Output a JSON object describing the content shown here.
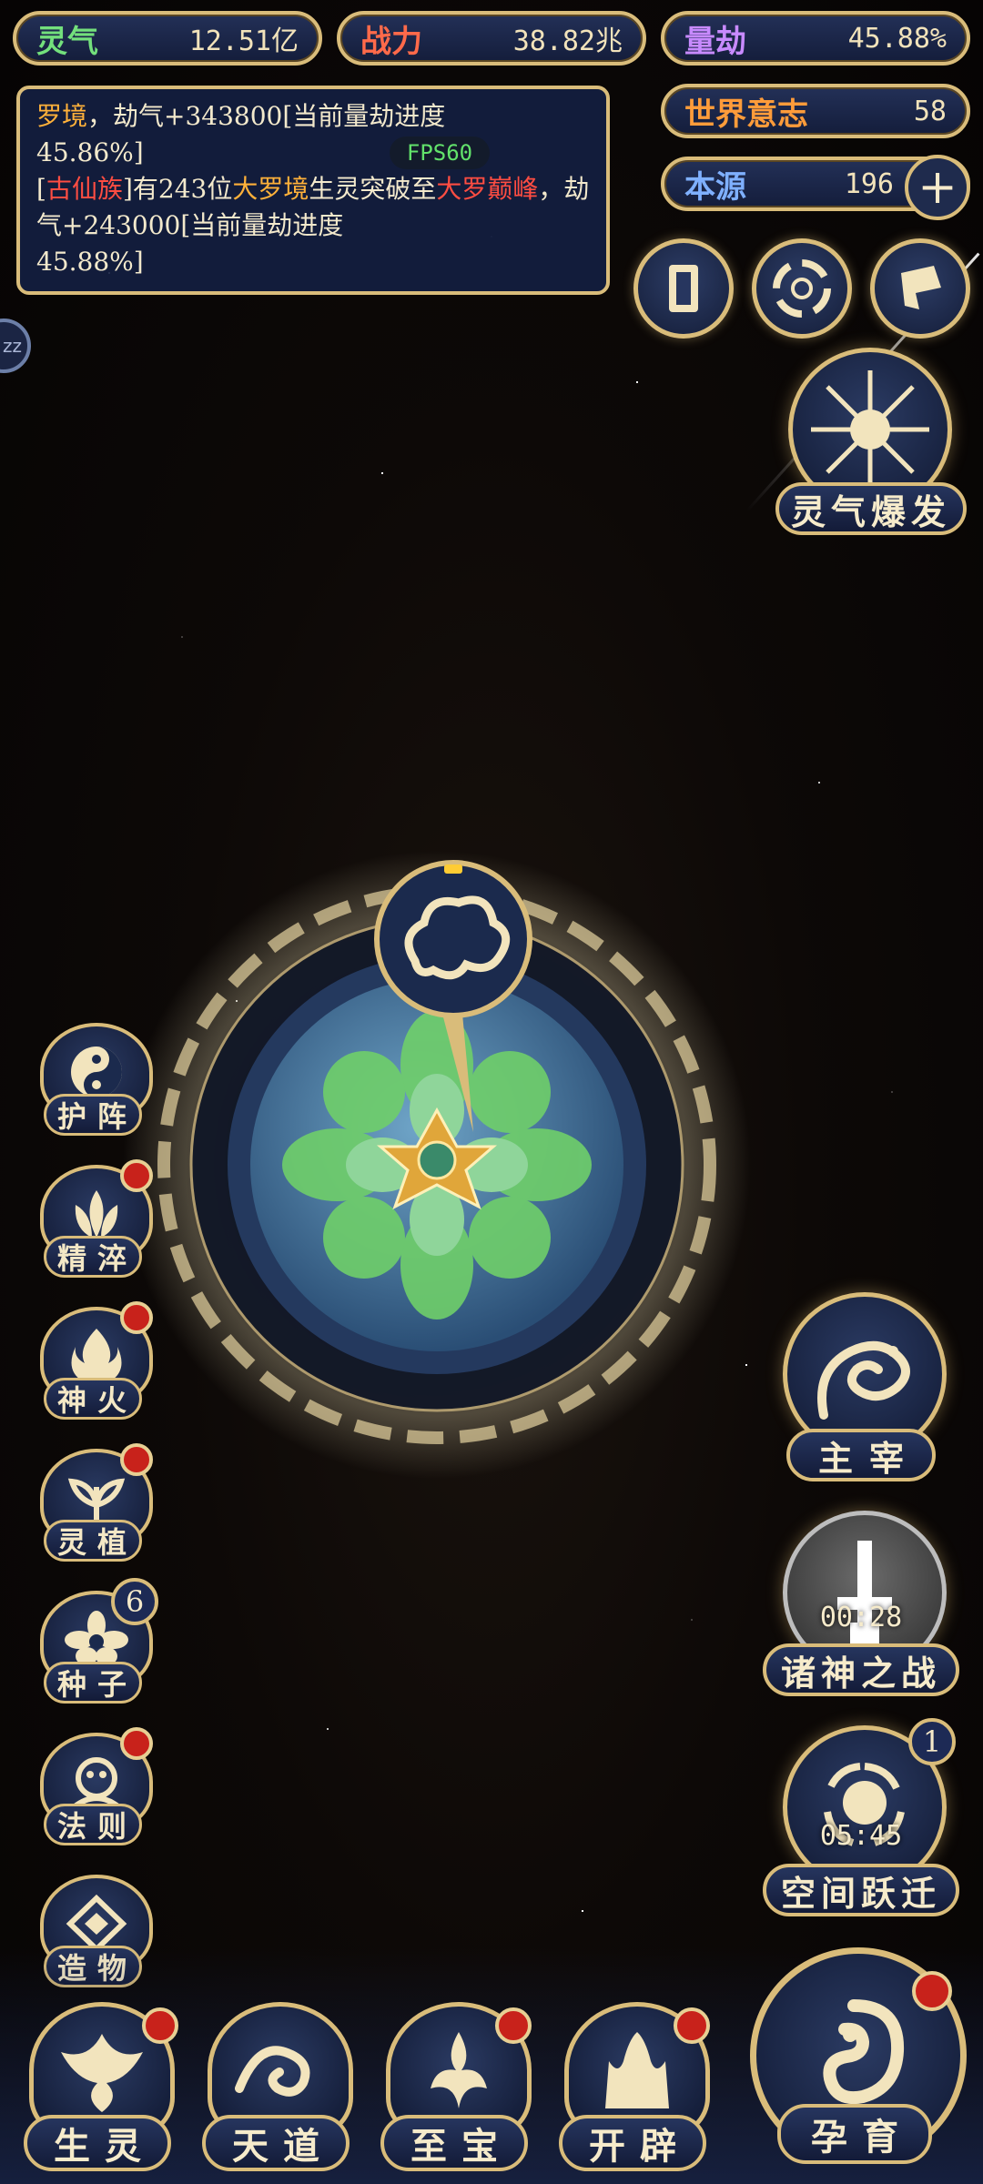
{
  "resources": {
    "lingqi": {
      "label": "灵气",
      "value": "12.51亿"
    },
    "zhanli": {
      "label": "战力",
      "value": "38.82兆"
    },
    "liangjie": {
      "label": "量劫",
      "value": "45.88%"
    },
    "shijie": {
      "label": "世界意志",
      "value": "58"
    },
    "benyuan": {
      "label": "本源",
      "value": "196"
    }
  },
  "log": {
    "line1_a": "罗境",
    "line1_b": "，劫气+343800[当前量劫进度",
    "line1_c": "45.86%]",
    "line2_bracket_open": "[",
    "line2_clan": "古仙族",
    "line2_bracket_close": "]有243位",
    "line2_realm": "大罗境",
    "line2_mid": "生灵突破至",
    "line2_target": "大罗巅峰",
    "line2_b": "，劫气+243000[当前量劫进度",
    "line2_c": "45.88%]"
  },
  "fps": "FPS60",
  "side_tab": "zz",
  "burst": {
    "label": "灵气爆发"
  },
  "left_menu": [
    {
      "label": "护阵",
      "icon": "yin-yang-icon",
      "badge": false
    },
    {
      "label": "精淬",
      "icon": "lotus-flame-icon",
      "badge": true
    },
    {
      "label": "神火",
      "icon": "fire-icon",
      "badge": true
    },
    {
      "label": "灵植",
      "icon": "plant-icon",
      "badge": true
    },
    {
      "label": "种子",
      "icon": "flower-icon",
      "badge_count": "6"
    },
    {
      "label": "法则",
      "icon": "law-beast-icon",
      "badge": true
    },
    {
      "label": "造物",
      "icon": "creation-icon",
      "badge": false
    }
  ],
  "right_features": {
    "ruler": {
      "label": "主宰"
    },
    "gods_war": {
      "label": "诸神之战",
      "timer": "00:28"
    },
    "space_jump": {
      "label": "空间跃迁",
      "timer": "05:45",
      "badge_count": "1"
    }
  },
  "bottom_nav": [
    {
      "label": "生灵"
    },
    {
      "label": "天道"
    },
    {
      "label": "至宝"
    },
    {
      "label": "开辟"
    },
    {
      "label": "孕育"
    }
  ],
  "colors": {
    "gold": "#d9bc7a",
    "navy": "#1a2648",
    "badge_red": "#c8221b",
    "orange": "#ffb13a",
    "red": "#ff4d42"
  }
}
